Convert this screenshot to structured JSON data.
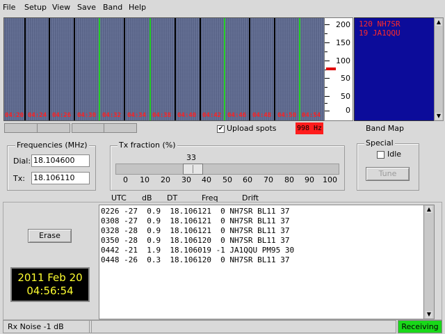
{
  "menu": [
    "File",
    "Setup",
    "View",
    "Save",
    "Band",
    "Help"
  ],
  "waterfall": {
    "time_labels": [
      "04:20",
      "04:24",
      "04:26",
      "04:30",
      "04:32",
      "04:34",
      "04:38",
      "04:40",
      "04:42",
      "04:46",
      "04:48",
      "04:50",
      "04:54"
    ],
    "scale_ticks": [
      "200",
      "150",
      "100",
      "50",
      "0"
    ],
    "colors": {
      "background": "#5e6a92",
      "separator": "#000000",
      "highlight": "#22cc22",
      "label": "#ff2020"
    }
  },
  "bandmap": {
    "entries": [
      {
        "freq": "120",
        "call": "NH7SR"
      },
      {
        "freq": " 19",
        "call": "JA1QQU"
      }
    ],
    "label": "Band Map"
  },
  "upload_spots": {
    "label": "Upload spots",
    "checked": true
  },
  "rx_offset": "998 Hz",
  "frequencies": {
    "title": "Frequencies (MHz)",
    "dial_label": "Dial:",
    "dial_value": "18.104600",
    "tx_label": "Tx:",
    "tx_value": "18.106110"
  },
  "tx_fraction": {
    "title": "Tx fraction (%)",
    "value": "33",
    "ticks": [
      "0",
      "10",
      "20",
      "30",
      "40",
      "50",
      "60",
      "70",
      "80",
      "90",
      "100"
    ]
  },
  "special": {
    "title": "Special",
    "idle_label": "Idle",
    "tune_label": "Tune"
  },
  "columns": [
    "UTC",
    "dB",
    "DT",
    "Freq",
    "Drift"
  ],
  "decodes": [
    "0226 -27  0.9  18.106121  0 NH7SR BL11 37",
    "0308 -27  0.9  18.106121  0 NH7SR BL11 37",
    "0328 -28  0.9  18.106121  0 NH7SR BL11 37",
    "0350 -28  0.9  18.106120  0 NH7SR BL11 37",
    "0442 -21  1.9  18.106019 -1 JA1QQU PM95 30",
    "0448 -26  0.3  18.106120  0 NH7SR BL11 37"
  ],
  "erase_label": "Erase",
  "clock": {
    "date": "2011 Feb 20",
    "time": "04:56:54"
  },
  "status": {
    "rx_noise": "Rx Noise -1 dB",
    "state": "Receiving"
  }
}
